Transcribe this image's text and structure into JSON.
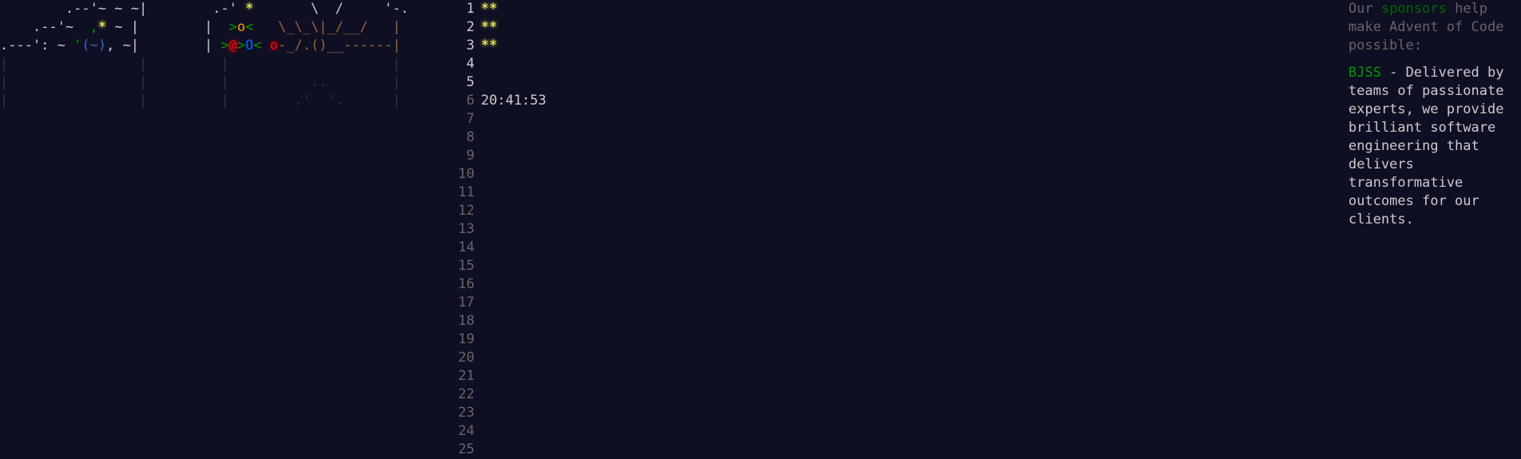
{
  "calendar": {
    "art": [
      {
        "segments": [
          {
            "t": "        .--'~ ~ ~|        .-' ",
            "c": "c-white"
          },
          {
            "t": "*",
            "c": "c-yellow"
          },
          {
            "t": "       \\  /     '-.",
            "c": "c-white"
          }
        ]
      },
      {
        "segments": [
          {
            "t": "    .--'~  ",
            "c": "c-white"
          },
          {
            "t": ",",
            "c": "c-green"
          },
          {
            "t": "*",
            "c": "c-yellow"
          },
          {
            "t": " ~ |        |  ",
            "c": "c-white"
          },
          {
            "t": ">",
            "c": "c-green"
          },
          {
            "t": "o",
            "c": "c-orange"
          },
          {
            "t": "<",
            "c": "c-green"
          },
          {
            "t": "   \\_\\_\\|_/__/   |",
            "c": "c-brown"
          }
        ]
      },
      {
        "segments": [
          {
            "t": ".---': ~ ",
            "c": "c-white"
          },
          {
            "t": "'",
            "c": "c-green"
          },
          {
            "t": "(~)",
            "c": "c-bluesea"
          },
          {
            "t": ", ~|        | ",
            "c": "c-white"
          },
          {
            "t": ">",
            "c": "c-green"
          },
          {
            "t": "@",
            "c": "c-red"
          },
          {
            "t": ">",
            "c": "c-green"
          },
          {
            "t": "O",
            "c": "c-blue"
          },
          {
            "t": "< ",
            "c": "c-green"
          },
          {
            "t": "o",
            "c": "c-red"
          },
          {
            "t": "-_/.()__------|",
            "c": "c-brown"
          }
        ]
      },
      {
        "segments": [
          {
            "t": "|                |         |                    |",
            "c": "c-dim2"
          }
        ]
      },
      {
        "segments": [
          {
            "t": "|                |         |          ..        |",
            "c": "c-dim2"
          }
        ]
      },
      {
        "segments": [
          {
            "t": "|                |         |        .'  '.      |",
            "c": "c-dim2"
          }
        ]
      }
    ],
    "days": [
      {
        "num": "1",
        "state": "completed",
        "stars": "**",
        "timer": ""
      },
      {
        "num": "2",
        "state": "completed",
        "stars": "**",
        "timer": ""
      },
      {
        "num": "3",
        "state": "completed",
        "stars": "**",
        "timer": ""
      },
      {
        "num": "4",
        "state": "unlocked",
        "stars": "",
        "timer": ""
      },
      {
        "num": "5",
        "state": "unlocked",
        "stars": "",
        "timer": ""
      },
      {
        "num": "6",
        "state": "locked",
        "stars": "",
        "timer": "20:41:53"
      },
      {
        "num": "7",
        "state": "locked",
        "stars": "",
        "timer": ""
      },
      {
        "num": "8",
        "state": "locked",
        "stars": "",
        "timer": ""
      },
      {
        "num": "9",
        "state": "locked",
        "stars": "",
        "timer": ""
      },
      {
        "num": "10",
        "state": "locked",
        "stars": "",
        "timer": ""
      },
      {
        "num": "11",
        "state": "locked",
        "stars": "",
        "timer": ""
      },
      {
        "num": "12",
        "state": "locked",
        "stars": "",
        "timer": ""
      },
      {
        "num": "13",
        "state": "locked",
        "stars": "",
        "timer": ""
      },
      {
        "num": "14",
        "state": "locked",
        "stars": "",
        "timer": ""
      },
      {
        "num": "15",
        "state": "locked",
        "stars": "",
        "timer": ""
      },
      {
        "num": "16",
        "state": "locked",
        "stars": "",
        "timer": ""
      },
      {
        "num": "17",
        "state": "locked",
        "stars": "",
        "timer": ""
      },
      {
        "num": "18",
        "state": "locked",
        "stars": "",
        "timer": ""
      },
      {
        "num": "19",
        "state": "locked",
        "stars": "",
        "timer": ""
      },
      {
        "num": "20",
        "state": "locked",
        "stars": "",
        "timer": ""
      },
      {
        "num": "21",
        "state": "locked",
        "stars": "",
        "timer": ""
      },
      {
        "num": "22",
        "state": "locked",
        "stars": "",
        "timer": ""
      },
      {
        "num": "23",
        "state": "locked",
        "stars": "",
        "timer": ""
      },
      {
        "num": "24",
        "state": "locked",
        "stars": "",
        "timer": ""
      },
      {
        "num": "25",
        "state": "locked",
        "stars": "",
        "timer": ""
      }
    ]
  },
  "sidebar": {
    "intro_prefix": "Our ",
    "intro_link": "sponsors",
    "intro_suffix": " help make Advent of Code possible:",
    "sponsor_name": "BJSS",
    "sponsor_text": " - Delivered by teams of passionate experts, we provide brilliant software engineering that delivers transformative outcomes for our clients."
  },
  "colors": {
    "background": "#0f0f23",
    "text": "#cccccc",
    "star_gold": "#ffff66",
    "link_green": "#009900",
    "dim_gray": "#666666"
  }
}
